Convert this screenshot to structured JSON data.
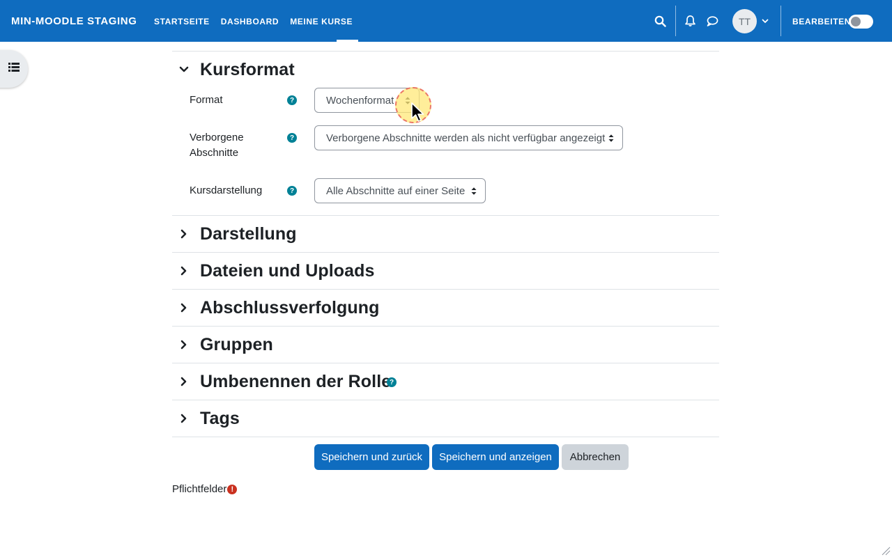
{
  "navbar": {
    "brand": "MIN-MOODLE STAGING",
    "items": [
      {
        "label": "STARTSEITE"
      },
      {
        "label": "DASHBOARD"
      },
      {
        "label": "MEINE KURSE"
      }
    ],
    "avatar_initials": "TT",
    "edit_mode_label": "BEARBEITEN",
    "icons": [
      "search-icon",
      "bell-icon",
      "chat-icon",
      "chevron-down-icon"
    ]
  },
  "drawer": {
    "icon": "list-icon"
  },
  "kursformat": {
    "title": "Kursformat",
    "fields": {
      "format": {
        "label": "Format",
        "value": "Wochenformat"
      },
      "hidden_sections": {
        "label": "Verborgene Abschnitte",
        "value": "Verborgene Abschnitte werden als nicht verfügbar angezeigt"
      },
      "layout": {
        "label": "Kursdarstellung",
        "value": "Alle Abschnitte auf einer Seite"
      }
    }
  },
  "sections": [
    {
      "title": "Darstellung"
    },
    {
      "title": "Dateien und Uploads"
    },
    {
      "title": "Abschlussverfolgung"
    },
    {
      "title": "Gruppen"
    },
    {
      "title": "Umbenennen der Rolle"
    },
    {
      "title": "Tags"
    }
  ],
  "buttons": {
    "save_return": "Speichern und zurück",
    "save_display": "Speichern und anzeigen",
    "cancel": "Abbrechen"
  },
  "required_label": "Pflichtfelder",
  "colors": {
    "brand": "#0f6cbf",
    "help": "#008196",
    "required": "#ca3120"
  }
}
